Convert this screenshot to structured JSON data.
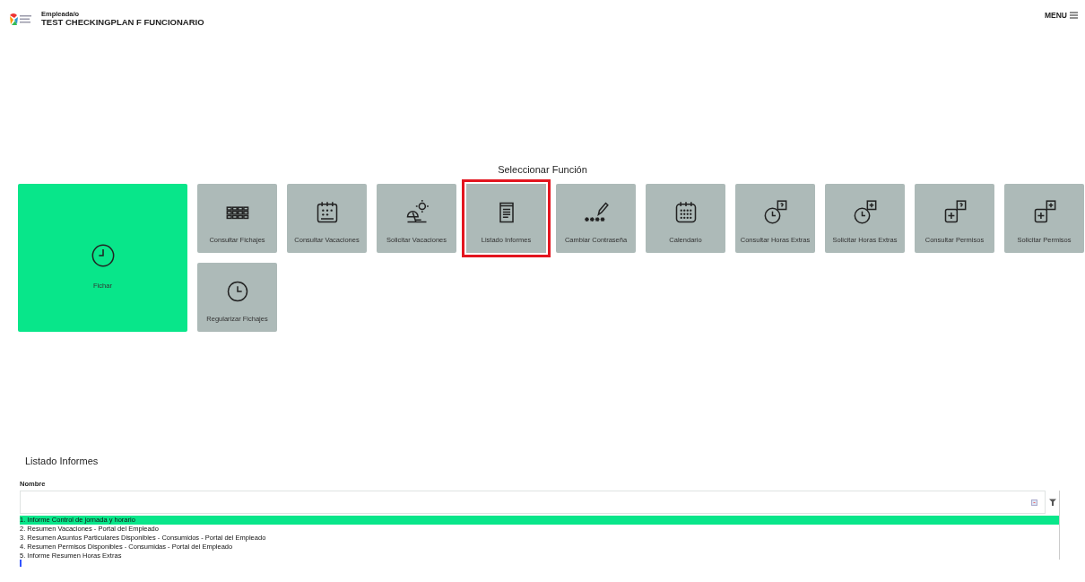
{
  "header": {
    "role": "Empleada/o",
    "user": "TEST CHECKINGPLAN F FUNCIONARIO",
    "menu": "MENU"
  },
  "functions": {
    "title": "Seleccionar Función",
    "tiles": [
      {
        "label": "Fichar",
        "kind": "large",
        "selected": false
      },
      {
        "label": "Consultar Fichajes",
        "kind": "normal",
        "selected": false
      },
      {
        "label": "Consultar Vacaciones",
        "kind": "normal",
        "selected": false
      },
      {
        "label": "Solicitar Vacaciones",
        "kind": "normal",
        "selected": false
      },
      {
        "label": "Listado Informes",
        "kind": "normal",
        "selected": true
      },
      {
        "label": "Cambiar Contraseña",
        "kind": "normal",
        "selected": false
      },
      {
        "label": "Calendario",
        "kind": "normal",
        "selected": false
      },
      {
        "label": "Consultar Horas Extras",
        "kind": "normal",
        "selected": false
      },
      {
        "label": "Solicitar Horas Extras",
        "kind": "normal",
        "selected": false
      },
      {
        "label": "Consultar Permisos",
        "kind": "normal",
        "selected": false
      },
      {
        "label": "Solicitar Permisos",
        "kind": "normal",
        "selected": false
      },
      {
        "label": "Regularizar Fichajes",
        "kind": "normal",
        "selected": false
      }
    ]
  },
  "reports": {
    "title": "Listado Informes",
    "field_label": "Nombre",
    "items": [
      {
        "label": "1. Informe Control de jornada y horario",
        "selected": true
      },
      {
        "label": "2. Resumen Vacaciones - Portal del Empleado",
        "selected": false
      },
      {
        "label": "3. Resumen Asuntos Particulares Disponibles - Consumidos - Portal del Empleado",
        "selected": false
      },
      {
        "label": "4. Resumen Permisos Disponibles - Consumidas - Portal del Empleado",
        "selected": false
      },
      {
        "label": "5. Informe Resumen Horas Extras",
        "selected": false
      }
    ]
  }
}
